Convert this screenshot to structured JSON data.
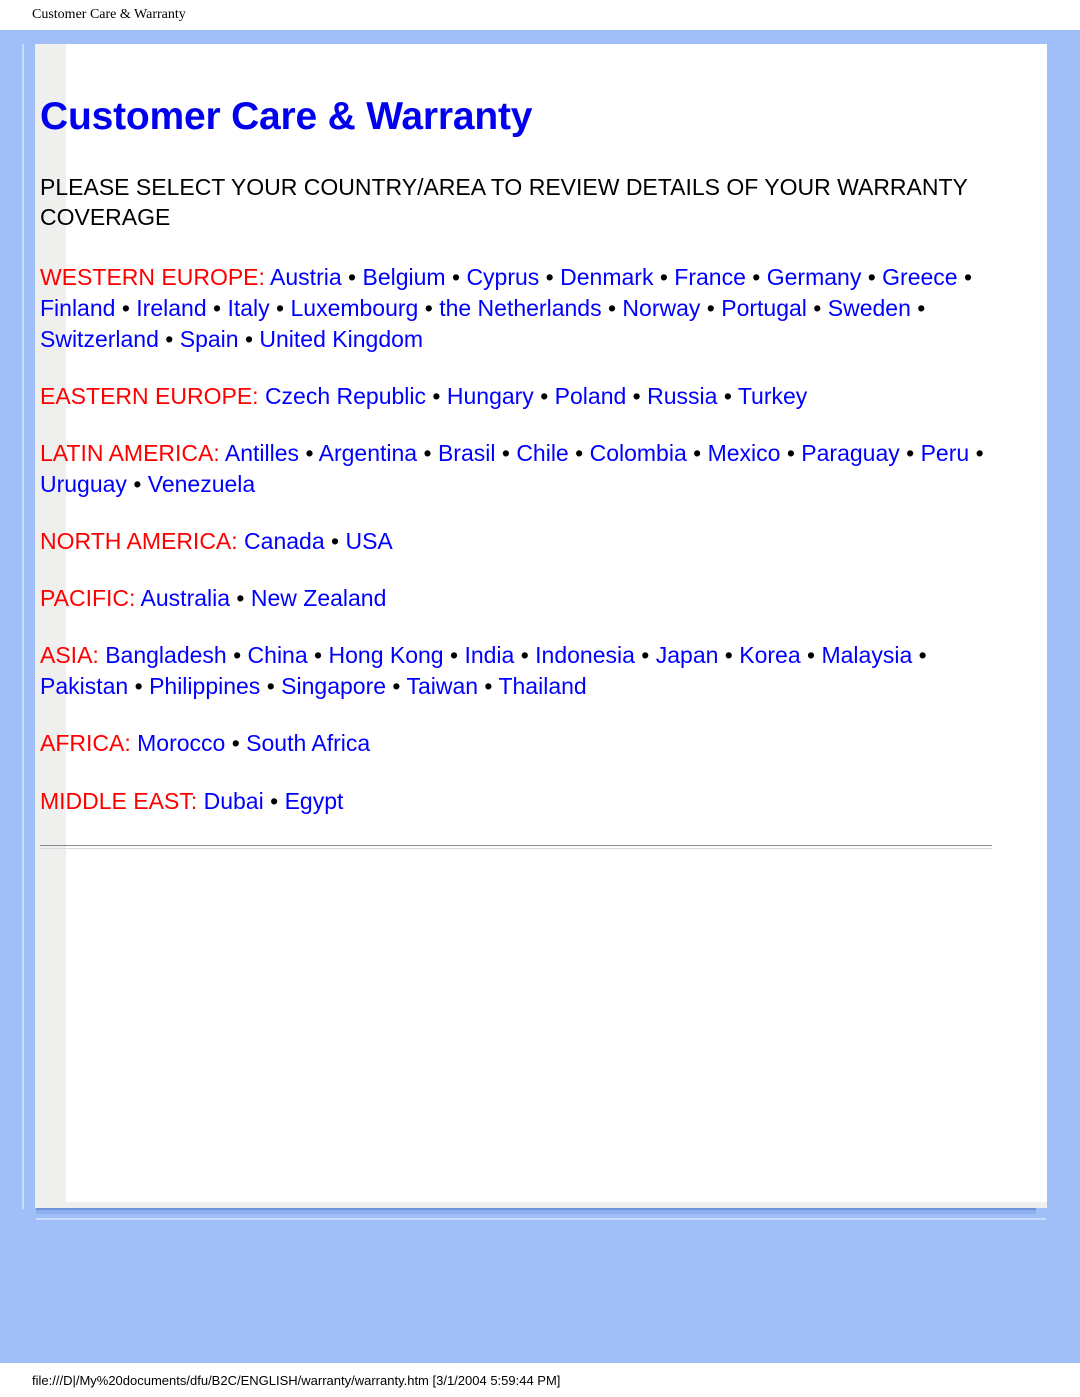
{
  "print_header": {
    "title": "Customer Care & Warranty"
  },
  "print_footer": {
    "path": "file:///D|/My%20documents/dfu/B2C/ENGLISH/warranty/warranty.htm [3/1/2004 5:59:44 PM]"
  },
  "document": {
    "title": "Customer Care & Warranty",
    "intro": "PLEASE SELECT YOUR COUNTRY/AREA TO REVIEW DETAILS OF YOUR WARRANTY COVERAGE",
    "separator": "•",
    "colors": {
      "title": "#0000EE",
      "region_label": "#FF0000",
      "country_link": "#0000FF",
      "page_background": "#A0BEF7",
      "sheet": "#FFFFFF"
    },
    "regions": [
      {
        "label": "WESTERN EUROPE:",
        "countries": [
          "Austria",
          "Belgium",
          "Cyprus",
          "Denmark",
          "France",
          "Germany",
          "Greece",
          "Finland",
          "Ireland",
          "Italy",
          "Luxembourg",
          "the Netherlands",
          "Norway",
          "Portugal",
          "Sweden",
          "Switzerland",
          "Spain",
          "United Kingdom"
        ]
      },
      {
        "label": "EASTERN EUROPE:",
        "countries": [
          "Czech Republic",
          "Hungary",
          "Poland",
          "Russia",
          "Turkey"
        ]
      },
      {
        "label": "LATIN AMERICA:",
        "countries": [
          "Antilles",
          "Argentina",
          "Brasil",
          "Chile",
          "Colombia",
          "Mexico",
          "Paraguay",
          "Peru",
          "Uruguay",
          "Venezuela"
        ]
      },
      {
        "label": "NORTH AMERICA:",
        "countries": [
          "Canada",
          "USA"
        ]
      },
      {
        "label": "PACIFIC:",
        "countries": [
          "Australia",
          "New Zealand"
        ]
      },
      {
        "label": "ASIA:",
        "countries": [
          "Bangladesh",
          "China",
          "Hong Kong",
          "India",
          "Indonesia",
          "Japan",
          "Korea",
          "Malaysia",
          "Pakistan",
          "Philippines",
          "Singapore",
          "Taiwan",
          "Thailand"
        ]
      },
      {
        "label": "AFRICA:",
        "countries": [
          "Morocco",
          "South Africa"
        ]
      },
      {
        "label": "MIDDLE EAST:",
        "countries": [
          "Dubai",
          "Egypt"
        ]
      }
    ]
  }
}
